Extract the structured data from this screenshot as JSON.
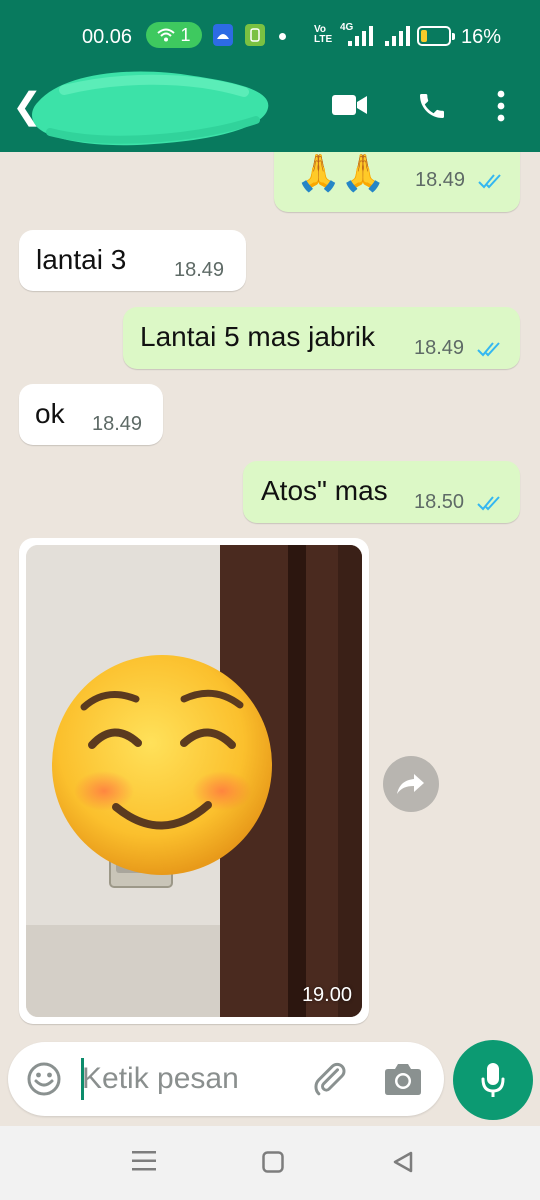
{
  "status_bar": {
    "time": "00.06",
    "hotspot_count": "1",
    "volte": "Vo\nLTE",
    "network": "4G",
    "battery": "16%",
    "battery_level": 0.16
  },
  "header": {
    "contact_name": "",
    "icons": [
      "back-arrow-icon",
      "video-call-icon",
      "voice-call-icon",
      "more-options-icon"
    ],
    "color": "#087A5E"
  },
  "messages": [
    {
      "direction": "outgoing",
      "text": "🙏🙏",
      "time": "18.49",
      "read": true
    },
    {
      "direction": "incoming",
      "text": "lantai   3",
      "time": "18.49"
    },
    {
      "direction": "outgoing",
      "text": "Lantai 5 mas jabrik",
      "time": "18.49",
      "read": true
    },
    {
      "direction": "incoming",
      "text": "ok",
      "time": "18.49"
    },
    {
      "direction": "outgoing",
      "text": "Atos\" mas",
      "time": "18.50",
      "read": true
    },
    {
      "direction": "incoming",
      "type": "image",
      "time": "19.00"
    }
  ],
  "composer": {
    "placeholder": "Ketik pesan",
    "icons": [
      "emoji-icon",
      "attach-icon",
      "camera-icon",
      "mic-icon"
    ]
  },
  "colors": {
    "chat_background": "#ECE5DD",
    "outgoing_bubble": "#DCF8C6",
    "incoming_bubble": "#FFFFFF",
    "read_ticks": "#34B7F1",
    "accent": "#0C9A72"
  }
}
